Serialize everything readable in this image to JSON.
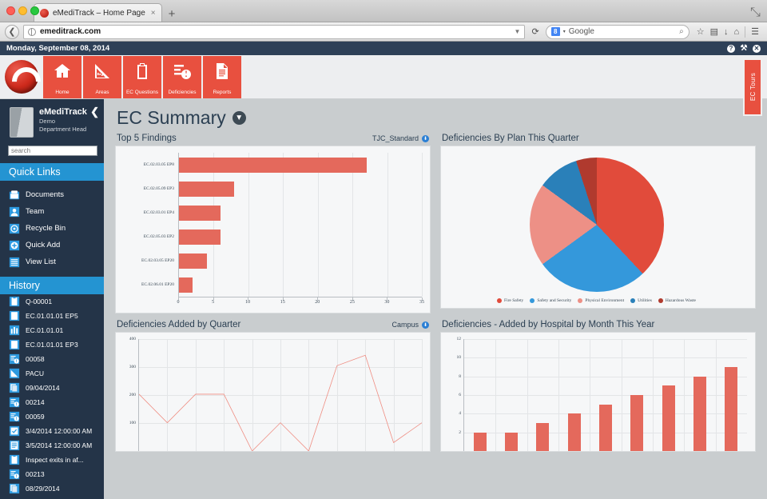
{
  "browser": {
    "tab_title": "eMediTrack – Home Page",
    "tab_close": "×",
    "new_tab": "+",
    "back": "❮",
    "reload": "⟳",
    "url": "emeditrack.com",
    "url_dropdown": "▼",
    "search_engine": "Google",
    "search_badge": "8",
    "search_caret": "▾",
    "search_icon": "⌕",
    "bookmark_icon": "☆",
    "pocket_icon": "▤",
    "download_icon": "↓",
    "home_icon": "⌂",
    "menu_icon": "☰",
    "maximize_icon": "⤡"
  },
  "datebar": {
    "date": "Monday, September 08, 2014",
    "help_icon": "?",
    "tools_icon": "⚒",
    "close_icon": "✕"
  },
  "topnav": {
    "items": [
      {
        "label": "Home",
        "icon": "home-icon"
      },
      {
        "label": "Areas",
        "icon": "ruler-icon"
      },
      {
        "label": "EC Questions",
        "icon": "clipboard-icon"
      },
      {
        "label": "Deficiencies",
        "icon": "alert-list-icon"
      },
      {
        "label": "Reports",
        "icon": "document-icon"
      }
    ],
    "side_tab": "EC Tours"
  },
  "sidebar": {
    "user_name": "eMediTrack",
    "user_role": "Demo",
    "user_title": "Department Head",
    "collapse_icon": "❮",
    "search_placeholder": "search",
    "quick_links_header": "Quick Links",
    "quick_links": [
      {
        "label": "Documents",
        "icon": "folder-icon"
      },
      {
        "label": "Team",
        "icon": "person-icon"
      },
      {
        "label": "Recycle Bin",
        "icon": "recycle-icon"
      },
      {
        "label": "Quick Add",
        "icon": "plus-circle-icon"
      },
      {
        "label": "View List",
        "icon": "list-icon"
      }
    ],
    "history_header": "History",
    "history": [
      {
        "label": "Q-00001",
        "icon": "clipboard-icon"
      },
      {
        "label": "EC.01.01.01 EP5",
        "icon": "page-icon"
      },
      {
        "label": "EC.01.01.01",
        "icon": "chart-icon"
      },
      {
        "label": "EC.01.01.01 EP3",
        "icon": "page-icon"
      },
      {
        "label": "00058",
        "icon": "alert-list-icon"
      },
      {
        "label": "PACU",
        "icon": "ruler-icon"
      },
      {
        "label": "09/04/2014",
        "icon": "copies-icon"
      },
      {
        "label": "00214",
        "icon": "alert-list-icon"
      },
      {
        "label": "00059",
        "icon": "alert-list-icon"
      },
      {
        "label": "3/4/2014 12:00:00 AM",
        "icon": "check-box-icon"
      },
      {
        "label": "3/5/2014 12:00:00 AM",
        "icon": "lines-icon"
      },
      {
        "label": "Inspect exits in af...",
        "icon": "clipboard-icon"
      },
      {
        "label": "00213",
        "icon": "alert-list-icon"
      },
      {
        "label": "08/29/2014",
        "icon": "copies-icon"
      }
    ]
  },
  "main": {
    "page_title": "EC Summary",
    "page_title_caret": "▼"
  },
  "colors": {
    "accent_red": "#e8503f",
    "bar_red": "#e4695c",
    "accent_blue": "#2494d2",
    "dark_navy": "#243448",
    "header_navy": "#2e4057"
  },
  "chart_data": [
    {
      "type": "bar",
      "orientation": "horizontal",
      "title": "Top 5 Findings",
      "filter_label": "TJC_Standard",
      "filter_icon": "⬇",
      "categories": [
        "EC.02.03.05 EP8",
        "EC.02.05.09 EP3",
        "EC.02.03.01 EP4",
        "EC.02.05.03 EP2",
        "EC.02.03.05 EP20",
        "EC.02.06.01 EP20"
      ],
      "values": [
        27,
        8,
        6,
        6,
        4,
        2
      ],
      "xlabel": "",
      "ylabel": "",
      "xlim": [
        0,
        35
      ],
      "xticks": [
        0,
        5,
        10,
        15,
        20,
        25,
        30,
        35
      ],
      "grid": true,
      "color": "#e4695c"
    },
    {
      "type": "pie",
      "title": "Deficiencies By Plan This Quarter",
      "labels": [
        "Fire Safety",
        "Safety and Security",
        "Physical Environment",
        "Utilities",
        "Hazardous Waste"
      ],
      "values": [
        38,
        27,
        20,
        10,
        5
      ],
      "colors": [
        "#e14b3b",
        "#3498db",
        "#ed9086",
        "#2a80b9",
        "#b03a2e"
      ],
      "legend_position": "bottom"
    },
    {
      "type": "line",
      "title": "Deficiencies Added by Quarter",
      "filter_label": "Campus",
      "filter_icon": "⬇",
      "x": [
        1,
        2,
        3,
        4,
        5,
        6,
        7,
        8,
        9,
        10,
        11
      ],
      "values": [
        203,
        101,
        203,
        203,
        0,
        101,
        0,
        305,
        342,
        30,
        101
      ],
      "ylim": [
        0,
        400
      ],
      "yticks": [
        100,
        200,
        300,
        400
      ],
      "grid": true,
      "color": "#ef8d82"
    },
    {
      "type": "bar",
      "orientation": "vertical",
      "title": "Deficiencies - Added by Hospital by Month This Year",
      "values": [
        2,
        2,
        3,
        4,
        5,
        6,
        7,
        8,
        9
      ],
      "ylim": [
        0,
        12
      ],
      "yticks": [
        2,
        4,
        6,
        8,
        10,
        12
      ],
      "grid": true,
      "color": "#e4695c"
    }
  ]
}
